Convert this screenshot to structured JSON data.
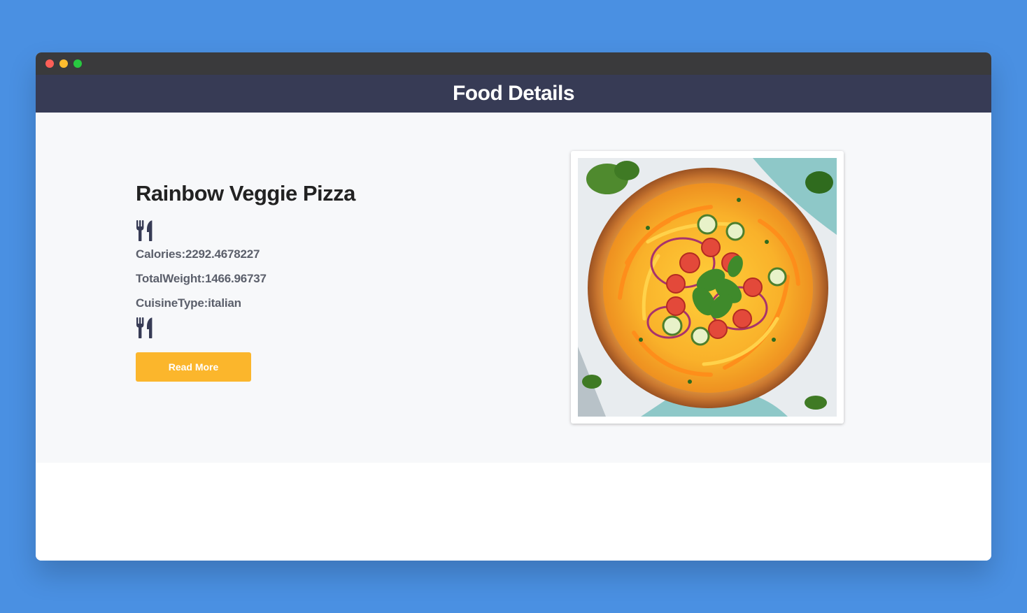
{
  "window": {
    "title_dots": [
      "close",
      "minimize",
      "maximize"
    ]
  },
  "header": {
    "title": "Food Details"
  },
  "food": {
    "name": "Rainbow Veggie Pizza",
    "calories": "Calories:2292.4678227",
    "total_weight": "TotalWeight:1466.96737",
    "cuisine_type": "CuisineType:italian",
    "icon": "utensils-icon",
    "read_more_label": "Read More",
    "image_icon": "pizza-photo"
  },
  "colors": {
    "page_bg": "#4a90e2",
    "header_bg": "#373b55",
    "titlebar_bg": "#3a3a3c",
    "accent_button": "#fbb62c",
    "content_bg": "#f7f8fa"
  }
}
